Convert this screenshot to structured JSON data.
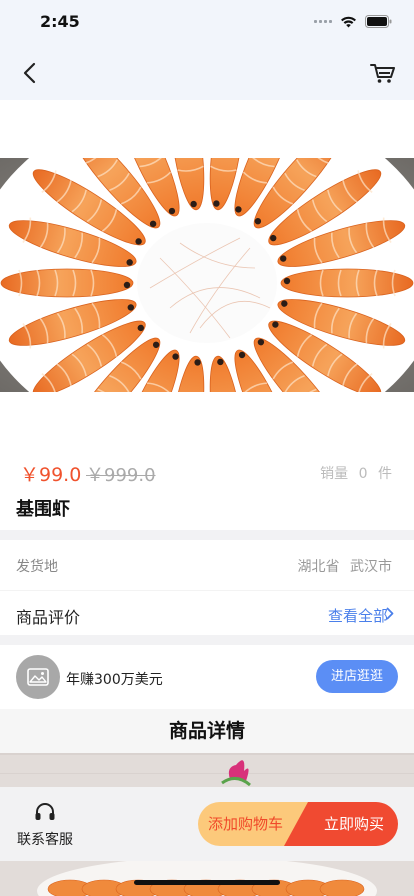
{
  "status_bar": {
    "time": "2:45"
  },
  "product": {
    "price": "￥99.0",
    "original_price": "￥999.0",
    "sales_label": "销量",
    "sales_count": "0",
    "sales_unit": "件",
    "name": "基围虾"
  },
  "shipping": {
    "label": "发货地",
    "province": "湖北省",
    "city": "武汉市"
  },
  "reviews": {
    "label": "商品评价",
    "view_all": "查看全部"
  },
  "shop": {
    "name": "年赚300万美元",
    "enter_button": "进店逛逛"
  },
  "details": {
    "title": "商品详情"
  },
  "bottom_bar": {
    "service_label": "联系客服",
    "add_cart_label": "添加购物车",
    "buy_now_label": "立即购买"
  },
  "colors": {
    "price": "#f0522d",
    "accent_blue": "#5b8ef5",
    "buy": "#f04a31",
    "add_cart": "#fcc97b"
  }
}
